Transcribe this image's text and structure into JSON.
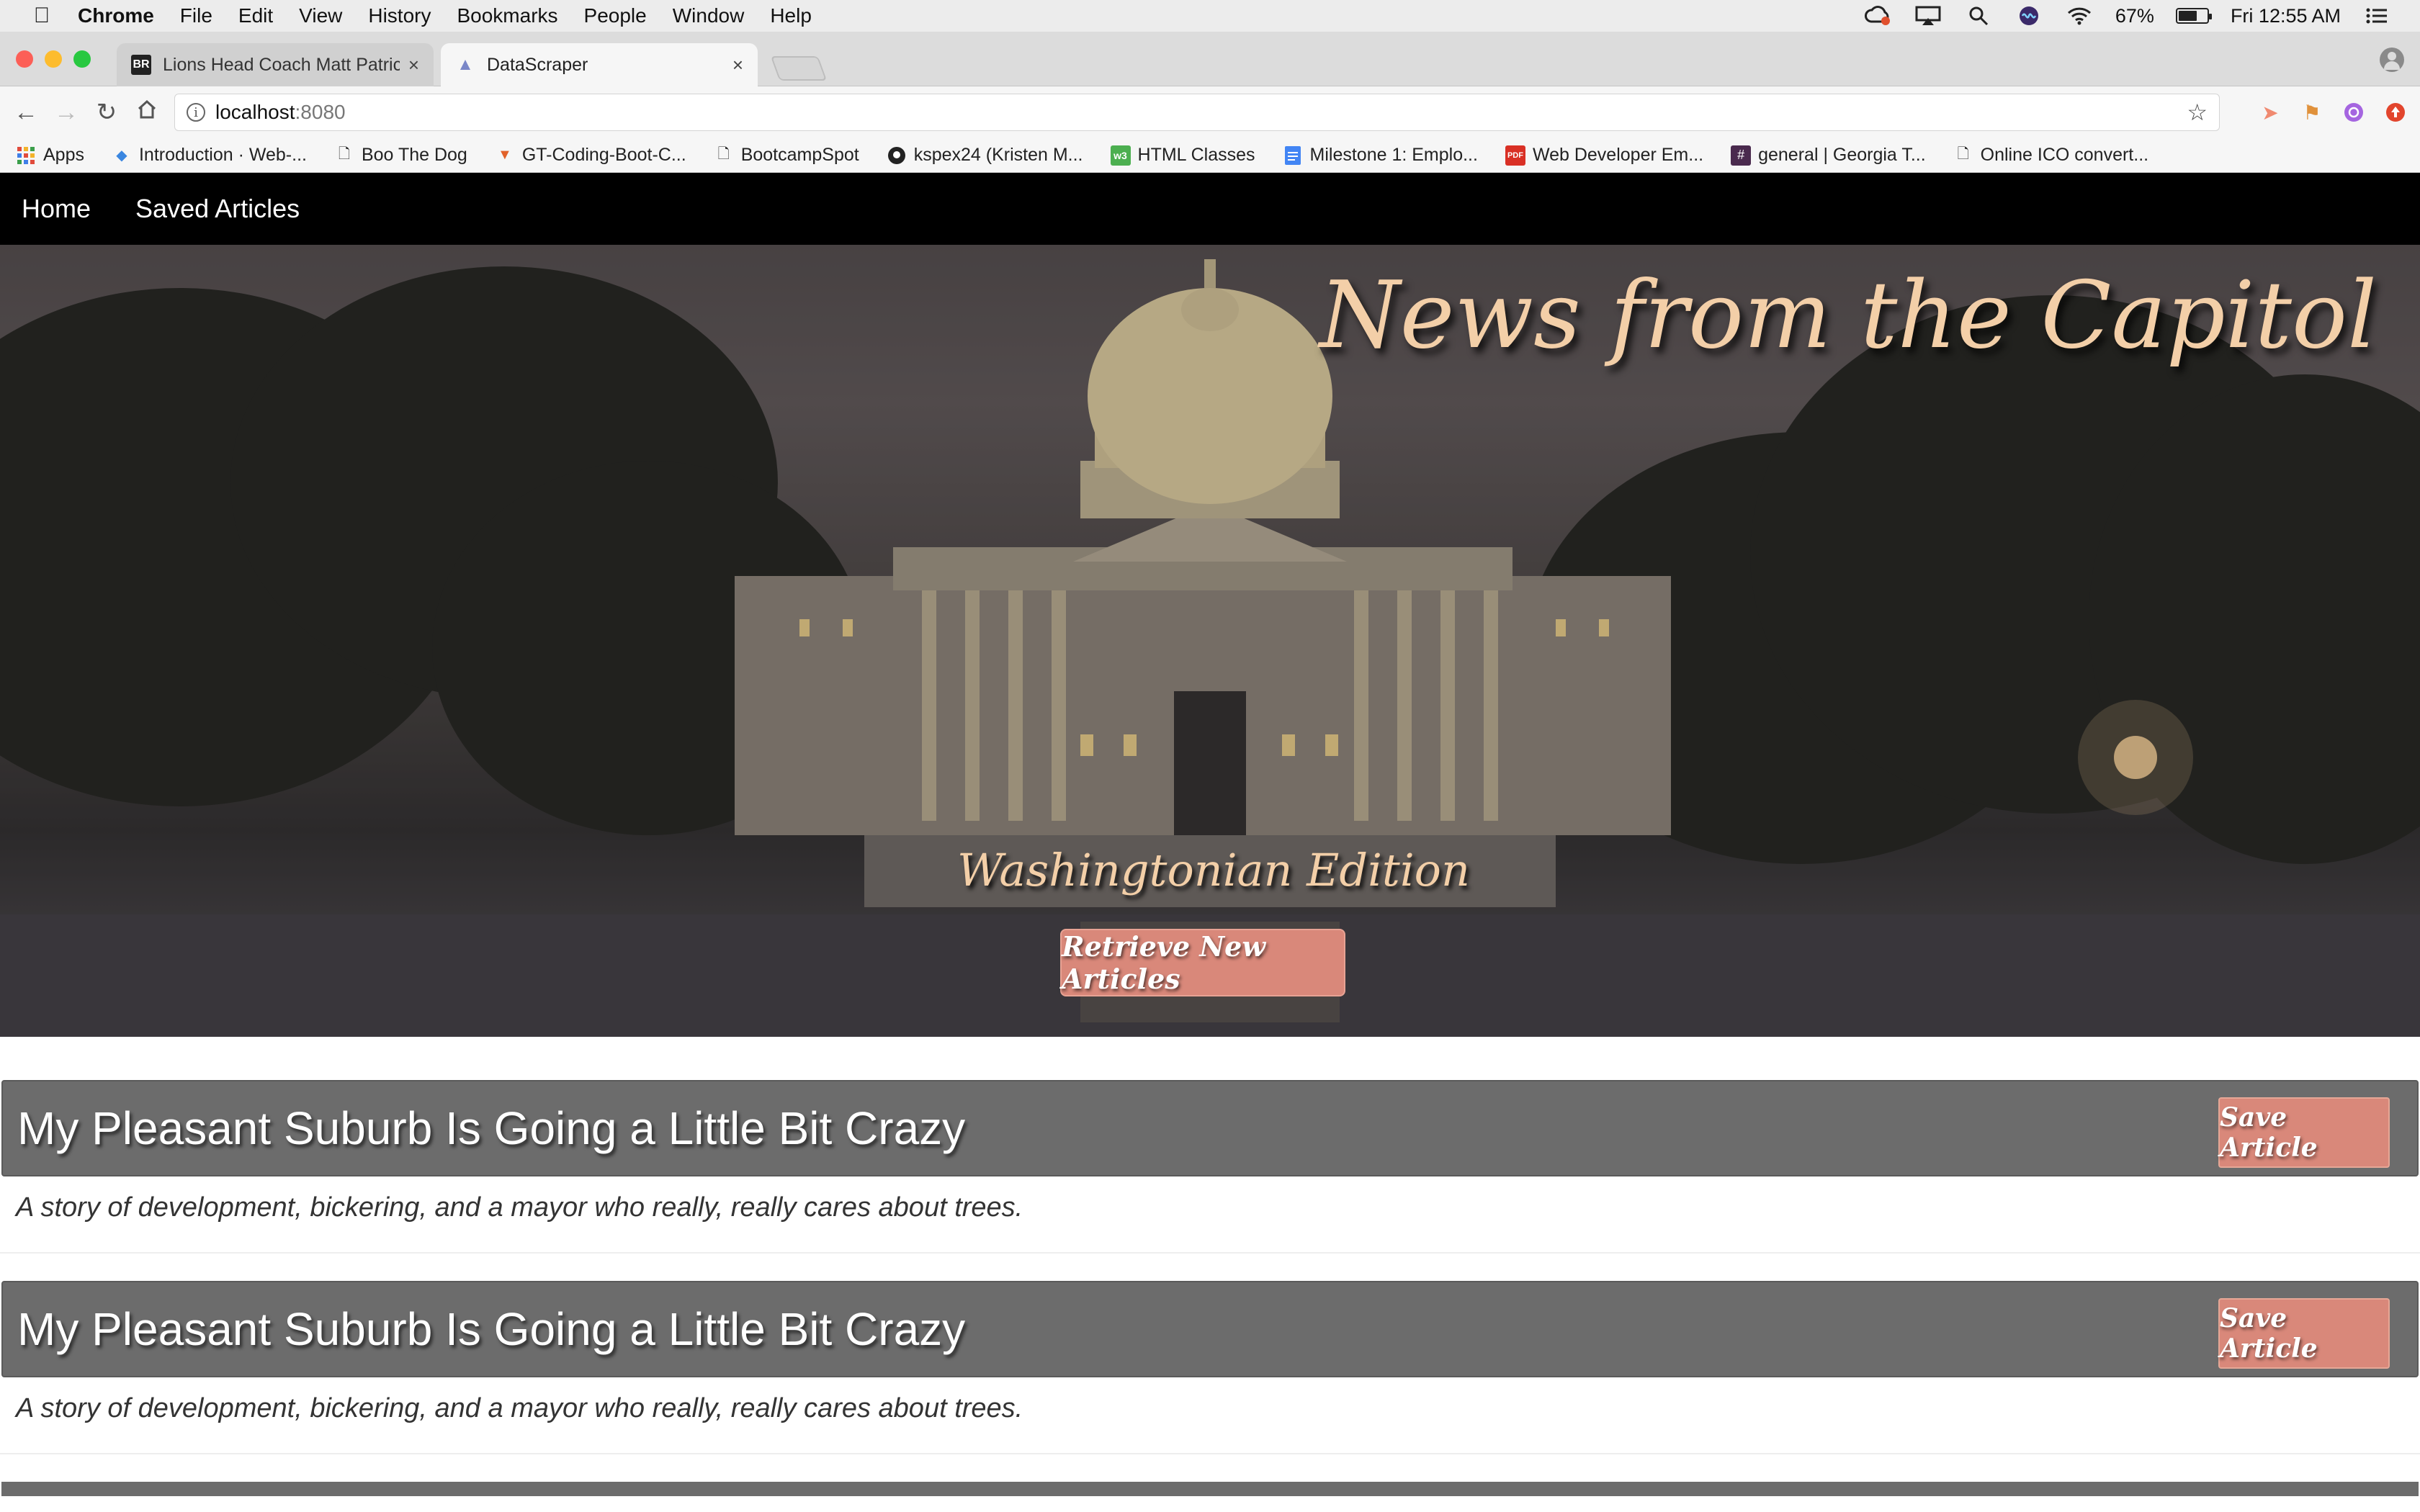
{
  "menubar": {
    "app_name": "Chrome",
    "menus": [
      "File",
      "Edit",
      "View",
      "History",
      "Bookmarks",
      "People",
      "Window",
      "Help"
    ],
    "battery_percent": "67%",
    "battery_level": 0.67,
    "clock": "Fri 12:55 AM"
  },
  "tabs": [
    {
      "title": "Lions Head Coach Matt Patricia",
      "favicon": "BR",
      "active": false
    },
    {
      "title": "DataScraper",
      "favicon": "capitol-icon",
      "active": true
    }
  ],
  "address_bar": {
    "host": "localhost",
    "port": ":8080"
  },
  "bookmarks": [
    {
      "label": "Apps",
      "icon": "apps-grid-icon"
    },
    {
      "label": "Introduction · Web-...",
      "icon": "gitbook-icon"
    },
    {
      "label": "Boo The Dog",
      "icon": "page-icon"
    },
    {
      "label": "GT-Coding-Boot-C...",
      "icon": "gitlab-icon"
    },
    {
      "label": "BootcampSpot",
      "icon": "page-icon"
    },
    {
      "label": "kspex24 (Kristen M...",
      "icon": "github-icon"
    },
    {
      "label": "HTML Classes",
      "icon": "w3-icon"
    },
    {
      "label": "Milestone 1: Emplo...",
      "icon": "docs-icon"
    },
    {
      "label": "Web Developer Em...",
      "icon": "pdf-icon"
    },
    {
      "label": "general | Georgia T...",
      "icon": "slack-icon"
    },
    {
      "label": "Online ICO convert...",
      "icon": "page-icon"
    }
  ],
  "site_nav": {
    "home": "Home",
    "saved": "Saved Articles"
  },
  "hero": {
    "title": "News from the Capitol",
    "subtitle": "Washingtonian Edition",
    "button": "Retrieve New Articles"
  },
  "articles": [
    {
      "title": "My Pleasant Suburb Is Going a Little Bit Crazy",
      "summary": "A story of development, bickering, and a mayor who really, really cares about trees.",
      "save_label": "Save Article"
    },
    {
      "title": "My Pleasant Suburb Is Going a Little Bit Crazy",
      "summary": "A story of development, bickering, and a mayor who really, really cares about trees.",
      "save_label": "Save Article"
    }
  ],
  "colors": {
    "accent": "#d9887a",
    "hero_text": "#f3cfa8",
    "nav_bg": "#000000",
    "article_header": "#6c6c6c"
  }
}
